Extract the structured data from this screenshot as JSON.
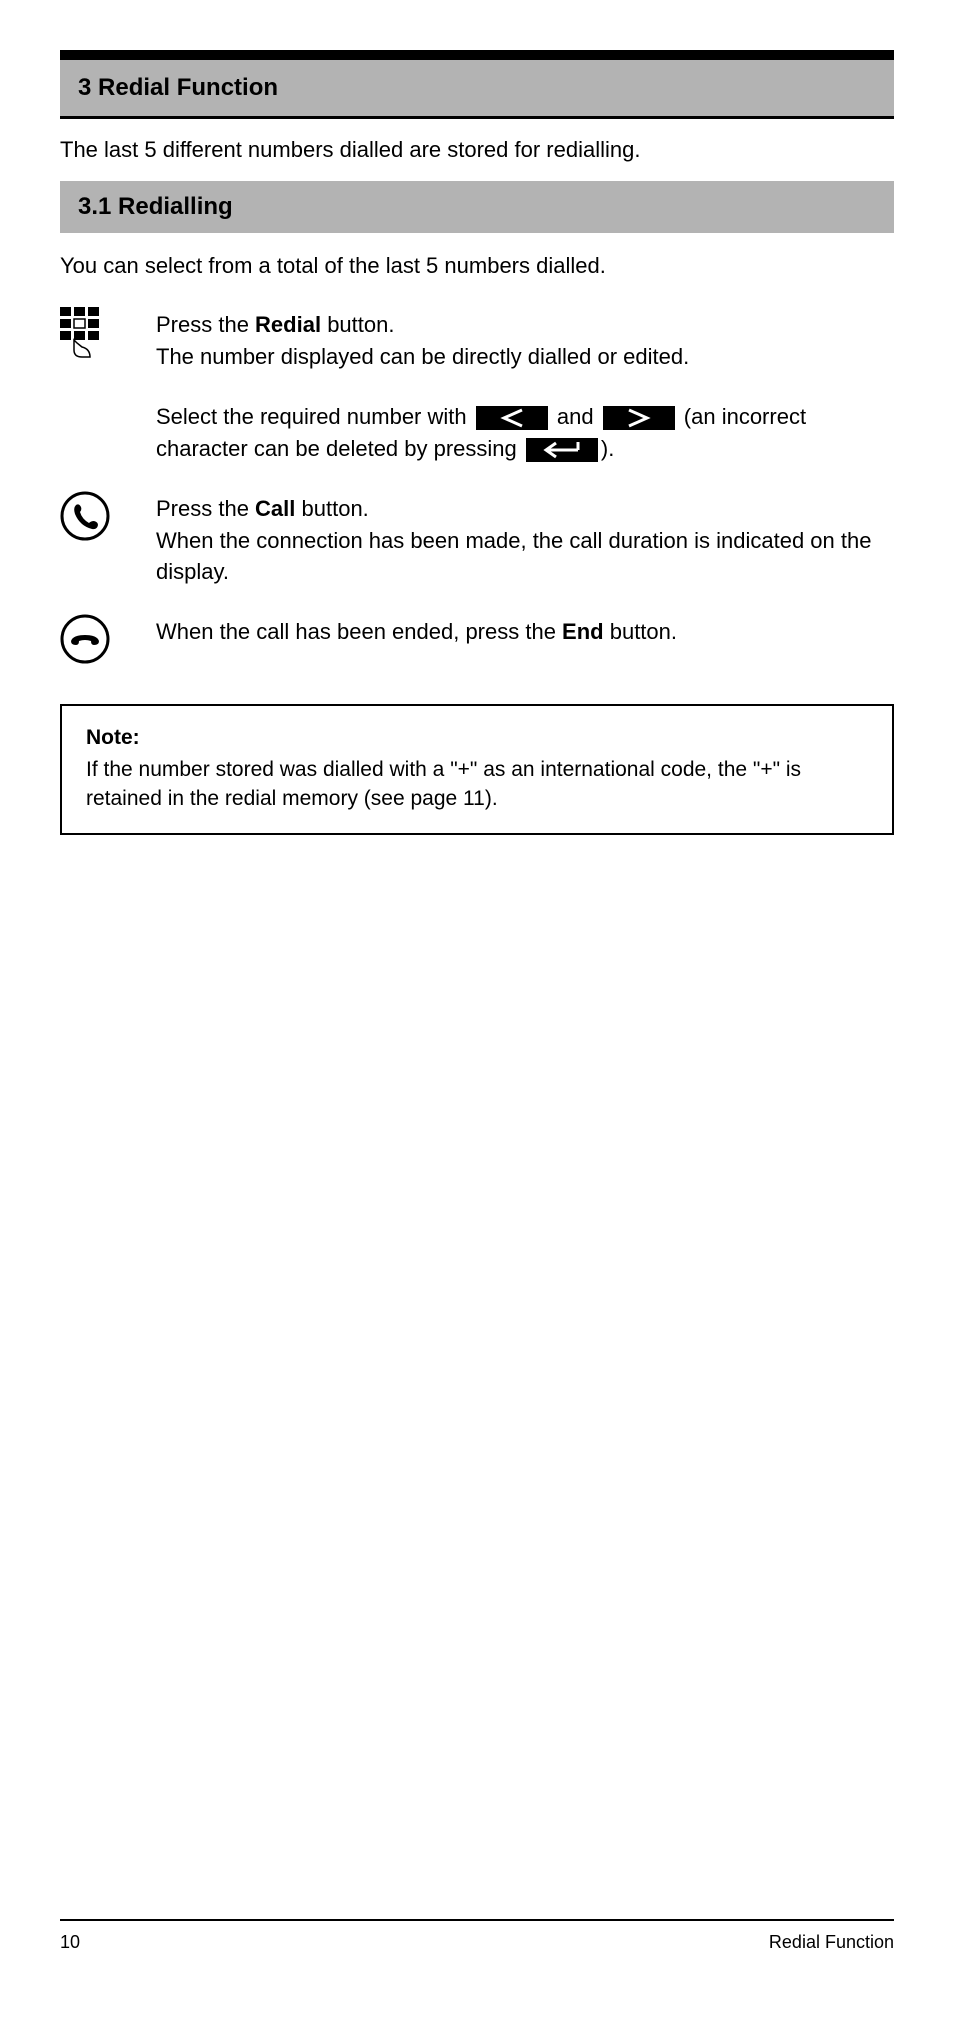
{
  "header": {
    "title": "3 Redial Function"
  },
  "intro": "The last 5 different numbers dialled are stored for redialling.",
  "subHeader": "3.1 Redialling",
  "body1": "You can select from a total of the last 5 numbers dialled.",
  "steps": {
    "step1": {
      "line1a": "Press the ",
      "line1b": "Redial",
      "line1c": " button.",
      "line2": "The number displayed can be directly dialled or edited."
    },
    "step2": {
      "line1a": "Select the required number with ",
      "line1b": " and ",
      "line1c": " (an incorrect character can be deleted by pressing ",
      "line1d": ")."
    },
    "step3": {
      "line1a": "Press the ",
      "line1b": "Call",
      "line1c": " button.",
      "line2": "When the connection has been made, the call duration is indicated on the display."
    },
    "step4": {
      "line1a": "When the call has been ended, press the ",
      "line1b": "End",
      "line1c": " button."
    }
  },
  "note": {
    "heading": "Note:",
    "body": "If the number stored was dialled with a \"+\" as an international code, the \"+\" is retained in the redial memory (see page 11)."
  },
  "footer": {
    "left": "10",
    "right": "Redial Function"
  }
}
